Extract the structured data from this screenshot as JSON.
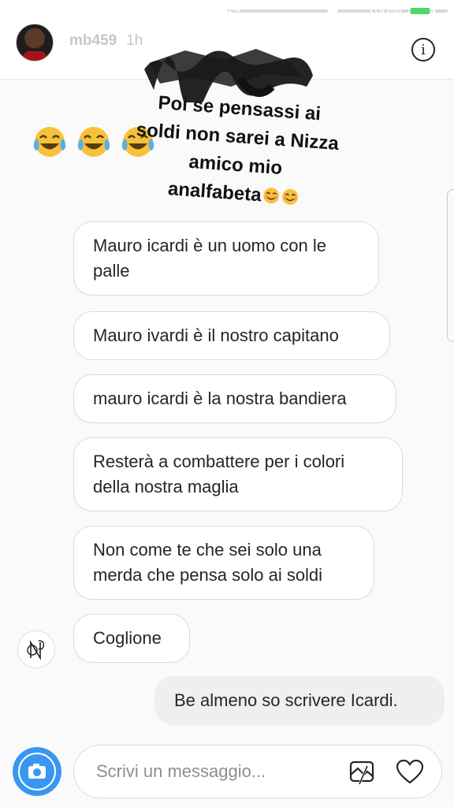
{
  "status_bar": {
    "signal": "●●●○○",
    "carrier": "Orange F",
    "network": "4G",
    "time": "09:49",
    "battery": "100%"
  },
  "story_progress": [
    1,
    1,
    0,
    0
  ],
  "header": {
    "username": "mb459",
    "age": "1h",
    "info_icon": "i"
  },
  "caption": {
    "lines": [
      "Poi se pensassi ai",
      "soldi non sarei a Nizza",
      "amico mio",
      "analfabeta"
    ]
  },
  "emojis": [
    "tears-of-joy",
    "tears-of-joy",
    "tears-of-joy"
  ],
  "messages": [
    {
      "text": "Mauro icardi è un uomo con le palle",
      "from": "other"
    },
    {
      "text": "Mauro ivardi è il nostro capitano",
      "from": "other"
    },
    {
      "text": "mauro icardi è la nostra bandiera",
      "from": "other"
    },
    {
      "text": "Resterà a combattere per i colori della nostra maglia",
      "from": "other"
    },
    {
      "text": "Non come te che sei solo una merda che pensa solo ai soldi",
      "from": "other"
    },
    {
      "text": "Coglione",
      "from": "other"
    },
    {
      "text": "Be almeno so scrivere Icardi.",
      "from": "me"
    }
  ],
  "composer": {
    "placeholder": "Scrivi un messaggio..."
  },
  "colors": {
    "accent": "#3897f0",
    "bubble_border": "#dbdbdb",
    "my_bubble": "#efefef",
    "battery_fill": "#4cd964"
  },
  "icons": [
    "camera-icon",
    "gallery-icon",
    "heart-icon",
    "info-icon"
  ]
}
